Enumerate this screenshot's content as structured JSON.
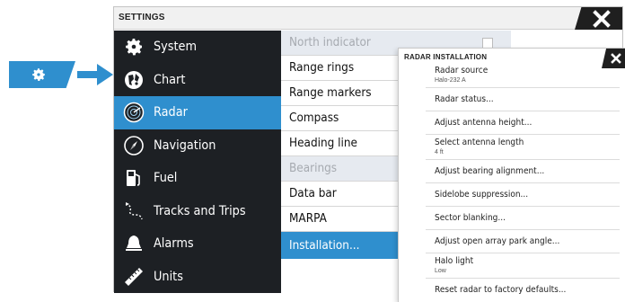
{
  "launcher": {
    "icon": "gear-icon",
    "accent": "#2f8fce"
  },
  "settings": {
    "title": "SETTINGS",
    "menu": [
      {
        "label": "System",
        "icon": "gear-icon"
      },
      {
        "label": "Chart",
        "icon": "chart-icon"
      },
      {
        "label": "Radar",
        "icon": "radar-icon",
        "active": true
      },
      {
        "label": "Navigation",
        "icon": "compass-icon"
      },
      {
        "label": "Fuel",
        "icon": "fuel-pump-icon"
      },
      {
        "label": "Tracks and Trips",
        "icon": "tracks-icon"
      },
      {
        "label": "Alarms",
        "icon": "bell-icon"
      },
      {
        "label": "Units",
        "icon": "ruler-icon"
      }
    ],
    "options": [
      {
        "label": "North indicator",
        "state": "disabled",
        "checkbox": true
      },
      {
        "label": "Range rings",
        "state": "normal"
      },
      {
        "label": "Range markers",
        "state": "normal"
      },
      {
        "label": "Compass",
        "state": "normal"
      },
      {
        "label": "Heading line",
        "state": "normal"
      },
      {
        "label": "Bearings",
        "state": "disabled"
      },
      {
        "label": "Data bar",
        "state": "normal"
      },
      {
        "label": "MARPA",
        "state": "normal"
      },
      {
        "label": "Installation...",
        "state": "active"
      }
    ]
  },
  "radar_installation": {
    "title": "RADAR INSTALLATION",
    "items": [
      {
        "label": "Radar source",
        "value": "Halo-232 A"
      },
      {
        "label": "Radar status..."
      },
      {
        "label": "Adjust antenna height..."
      },
      {
        "label": "Select antenna length",
        "value": "4 ft"
      },
      {
        "label": "Adjust bearing alignment..."
      },
      {
        "label": "Sidelobe suppression..."
      },
      {
        "label": "Sector blanking..."
      },
      {
        "label": "Adjust open array park angle..."
      },
      {
        "label": "Halo light",
        "value": "Low"
      },
      {
        "label": "Reset radar to factory defaults..."
      }
    ]
  },
  "colors": {
    "accent": "#2f8fce",
    "menu_bg": "#1d2024",
    "disabled_bg": "#e6eaf0"
  }
}
